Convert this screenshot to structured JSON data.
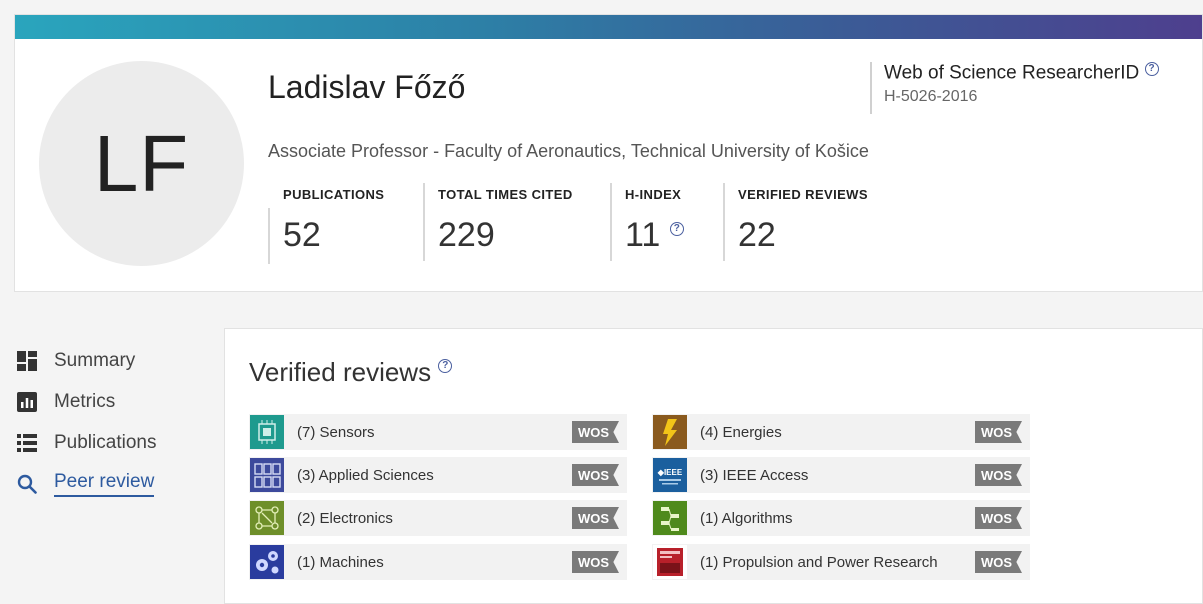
{
  "profile": {
    "initials": "LF",
    "name": "Ladislav Főző",
    "affiliation": "Associate Professor - Faculty of Aeronautics, Technical University of Košice",
    "researcher_id_title": "Web of Science ResearcherID",
    "researcher_id": "H-5026-2016",
    "help_symbol": "?"
  },
  "metrics": [
    {
      "label": "PUBLICATIONS",
      "value": "52"
    },
    {
      "label": "TOTAL TIMES CITED",
      "value": "229"
    },
    {
      "label": "H-INDEX",
      "value": "11"
    },
    {
      "label": "VERIFIED REVIEWS",
      "value": "22"
    }
  ],
  "sidebar": {
    "items": [
      {
        "label": "Summary",
        "icon": "dashboard-icon"
      },
      {
        "label": "Metrics",
        "icon": "bar-chart-icon"
      },
      {
        "label": "Publications",
        "icon": "list-icon"
      },
      {
        "label": "Peer review",
        "icon": "search-icon",
        "active": true
      }
    ]
  },
  "reviews": {
    "title": "Verified reviews",
    "badge": "WOS",
    "journals": [
      {
        "label": "(7) Sensors",
        "cover_color": "#1e9a8e"
      },
      {
        "label": "(3) Applied Sciences",
        "cover_color": "#3d4a9c"
      },
      {
        "label": "(2) Electronics",
        "cover_color": "#6e8f2a"
      },
      {
        "label": "(1) Machines",
        "cover_color": "#2a3c9e"
      },
      {
        "label": "(4) Energies",
        "cover_color": "#8a5a1e"
      },
      {
        "label": "(3) IEEE Access",
        "cover_color": "#1b5f9e"
      },
      {
        "label": "(1) Algorithms",
        "cover_color": "#4f8a1c"
      },
      {
        "label": "(1) Propulsion and Power Research",
        "cover_color": "#b8202a"
      }
    ]
  },
  "colors": {
    "accent": "#2d5a9f",
    "gradient_start": "#2aa5bd",
    "gradient_end": "#4e3f8e",
    "wos_badge": "#7a7a7a"
  }
}
